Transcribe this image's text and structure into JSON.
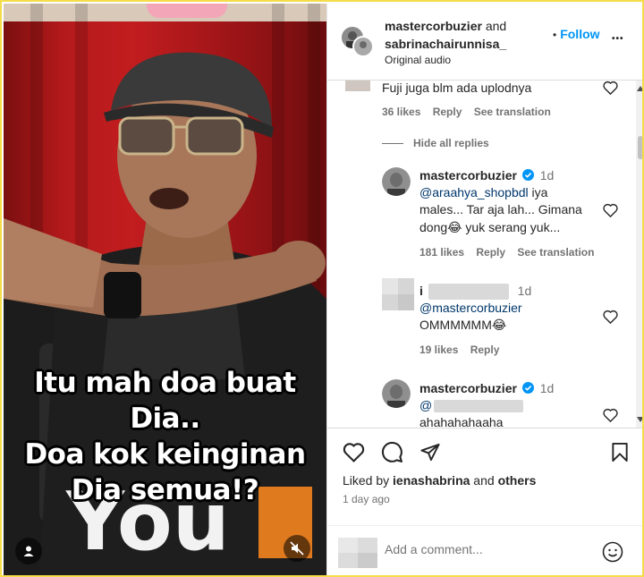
{
  "video": {
    "caption_lines": [
      "Itu mah doa buat",
      "Dia..",
      "Doa kok keinginan",
      "Dia semua!?"
    ]
  },
  "header": {
    "user1": "mastercorbuzier",
    "and_text": "and",
    "user2": "sabrinachairunnisa_",
    "follow_label": "Follow",
    "follow_dot": "•",
    "more_label": "•••",
    "audio_label": "Original audio"
  },
  "comments": {
    "top_comment_text": "Fuji juga blm ada uplodnya",
    "top_comment_likes": "36 likes",
    "reply_label": "Reply",
    "see_translation_label": "See translation",
    "hide_replies_label": "Hide all replies",
    "reply1": {
      "user": "mastercorbuzier",
      "time": "1d",
      "mention": "@araahya_shopbdl",
      "text_line1": " iya",
      "text_line2": "males... Tar aja lah... Gimana",
      "text_line3a": "dong",
      "emoji": "😂",
      "text_line3b": " yuk serang yuk...",
      "likes": "181 likes"
    },
    "reply2": {
      "user_initial": "i",
      "time": "1d",
      "mention": "@mastercorbuzier",
      "text": "OMMMMMM",
      "emoji": "😂",
      "likes": "19 likes"
    },
    "reply3": {
      "user": "mastercorbuzier",
      "time": "1d",
      "mention_start": "@",
      "text": "ahahahahaaha"
    }
  },
  "actions": {
    "liked_by_prefix": "Liked by ",
    "liked_by_user": "ienashabrina",
    "liked_by_and": " and ",
    "liked_by_others": "others",
    "timestamp": "1 day ago"
  },
  "comment_box": {
    "placeholder": "Add a comment..."
  },
  "colors": {
    "follow_blue": "#0095f6",
    "verified_blue": "#0095f6",
    "mention_link": "#00376b",
    "frame_border": "#f5dc4a"
  }
}
